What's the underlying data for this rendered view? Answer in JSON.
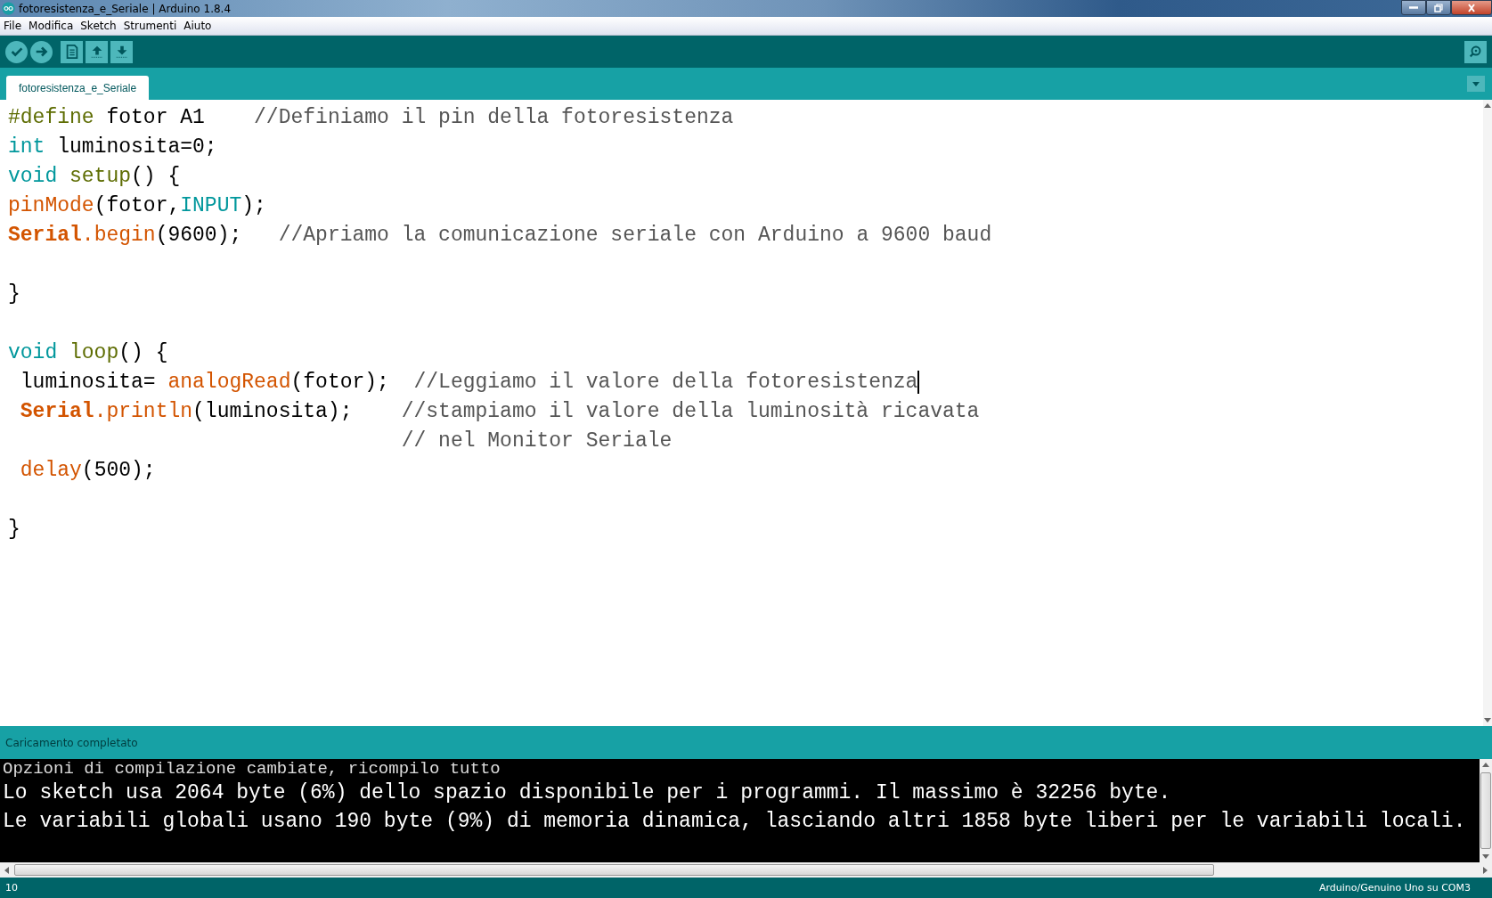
{
  "window": {
    "title": "fotoresistenza_e_Seriale | Arduino 1.8.4"
  },
  "menu": [
    "File",
    "Modifica",
    "Sketch",
    "Strumenti",
    "Aiuto"
  ],
  "tabs": [
    {
      "label": "fotoresistenza_e_Seriale",
      "selected": true
    }
  ],
  "editor": {
    "lines": [
      {
        "kind": "code",
        "tokens": [
          {
            "kind": "preproc",
            "text": "#define"
          },
          {
            "kind": "plain",
            "text": " fotor A1    "
          },
          {
            "kind": "comment",
            "text": "//Definiamo il pin della fotoresistenza"
          }
        ]
      },
      {
        "kind": "code",
        "tokens": [
          {
            "kind": "type",
            "text": "int"
          },
          {
            "kind": "plain",
            "text": " luminosita=0;"
          }
        ]
      },
      {
        "kind": "code",
        "tokens": [
          {
            "kind": "type",
            "text": "void "
          },
          {
            "kind": "fndef",
            "text": "setup"
          },
          {
            "kind": "plain",
            "text": "() {"
          }
        ]
      },
      {
        "kind": "code",
        "tokens": [
          {
            "kind": "func",
            "text": "pinMode"
          },
          {
            "kind": "plain",
            "text": "(fotor,"
          },
          {
            "kind": "constant",
            "text": "INPUT"
          },
          {
            "kind": "plain",
            "text": ");"
          }
        ]
      },
      {
        "kind": "code",
        "tokens": [
          {
            "kind": "class",
            "text": "Serial"
          },
          {
            "kind": "func",
            "text": ".begin"
          },
          {
            "kind": "plain",
            "text": "(9600);   "
          },
          {
            "kind": "comment",
            "text": "//Apriamo la comunicazione seriale con Arduino a 9600 baud"
          }
        ]
      },
      {
        "kind": "blank"
      },
      {
        "kind": "code",
        "tokens": [
          {
            "kind": "plain",
            "text": "}"
          }
        ]
      },
      {
        "kind": "blank"
      },
      {
        "kind": "code",
        "tokens": [
          {
            "kind": "type",
            "text": "void "
          },
          {
            "kind": "fndef",
            "text": "loop"
          },
          {
            "kind": "plain",
            "text": "() {"
          }
        ]
      },
      {
        "kind": "code",
        "tokens": [
          {
            "kind": "plain",
            "text": " luminosita= "
          },
          {
            "kind": "func",
            "text": "analogRead"
          },
          {
            "kind": "plain",
            "text": "(fotor);  "
          },
          {
            "kind": "comment",
            "text": "//Leggiamo il valore della fotoresistenza",
            "caret": true
          }
        ]
      },
      {
        "kind": "code",
        "tokens": [
          {
            "kind": "class",
            "text": " Serial"
          },
          {
            "kind": "func",
            "text": ".println"
          },
          {
            "kind": "plain",
            "text": "(luminosita);    "
          },
          {
            "kind": "comment",
            "text": "//stampiamo il valore della luminosità ricavata"
          }
        ]
      },
      {
        "kind": "code",
        "tokens": [
          {
            "kind": "comment",
            "text": "                                // nel Monitor Seriale"
          }
        ]
      },
      {
        "kind": "code",
        "tokens": [
          {
            "kind": "func",
            "text": " delay"
          },
          {
            "kind": "plain",
            "text": "(500);"
          }
        ]
      },
      {
        "kind": "blank"
      },
      {
        "kind": "code",
        "tokens": [
          {
            "kind": "plain",
            "text": "}"
          }
        ]
      }
    ]
  },
  "status": "Caricamento completato",
  "console": [
    "Opzioni di compilazione cambiate, ricompilo tutto",
    "Lo sketch usa 2064 byte (6%) dello spazio disponibile per i programmi. Il massimo è 32256 byte.",
    "Le variabili globali usano 190 byte (9%) di memoria dinamica, lasciando altri 1858 byte liberi per le variabili locali."
  ],
  "status_bar": {
    "line": "10",
    "board": "Arduino/Genuino Uno su COM3"
  }
}
